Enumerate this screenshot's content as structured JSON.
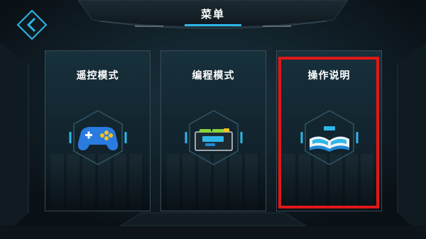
{
  "header": {
    "title": "菜单"
  },
  "menu": {
    "items": [
      {
        "label": "遥控模式",
        "icon": "gamepad-icon"
      },
      {
        "label": "编程模式",
        "icon": "code-blocks-icon"
      },
      {
        "label": "操作说明",
        "icon": "open-book-icon"
      }
    ],
    "highlighted_index": 2
  },
  "colors": {
    "background": "#0b1218",
    "accent": "#2fb6e8",
    "highlight": "#e01818",
    "card": "#152c37"
  }
}
